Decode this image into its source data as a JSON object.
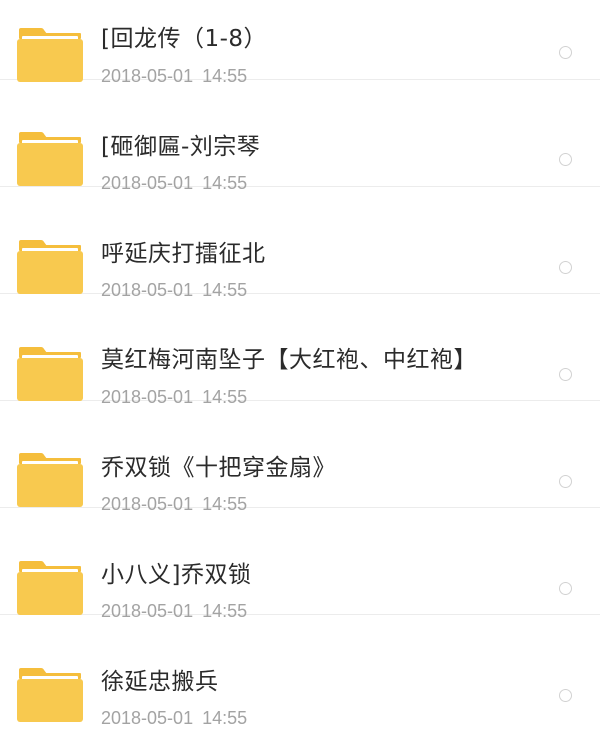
{
  "folders": [
    {
      "name": "[回龙传（1-8）",
      "date": "2018-05-01",
      "time": "14:55"
    },
    {
      "name": "[砸御匾-刘宗琴",
      "date": "2018-05-01",
      "time": "14:55"
    },
    {
      "name": "呼延庆打擂征北",
      "date": "2018-05-01",
      "time": "14:55"
    },
    {
      "name": "莫红梅河南坠子【大红袍、中红袍】",
      "date": "2018-05-01",
      "time": "14:55"
    },
    {
      "name": "乔双锁《十把穿金扇》",
      "date": "2018-05-01",
      "time": "14:55"
    },
    {
      "name": "小八义]乔双锁",
      "date": "2018-05-01",
      "time": "14:55"
    },
    {
      "name": "徐延忠搬兵",
      "date": "2018-05-01",
      "time": "14:55"
    }
  ],
  "icons": {
    "folder": "folder-icon",
    "select": "select-radio"
  },
  "colors": {
    "folder_body": "#F8C94F",
    "folder_tab": "#F5BE3C",
    "folder_paper": "#FFFFFF",
    "name_text": "#2B2B2B",
    "date_text": "#A3A3A3",
    "divider": "#ECECEC"
  }
}
